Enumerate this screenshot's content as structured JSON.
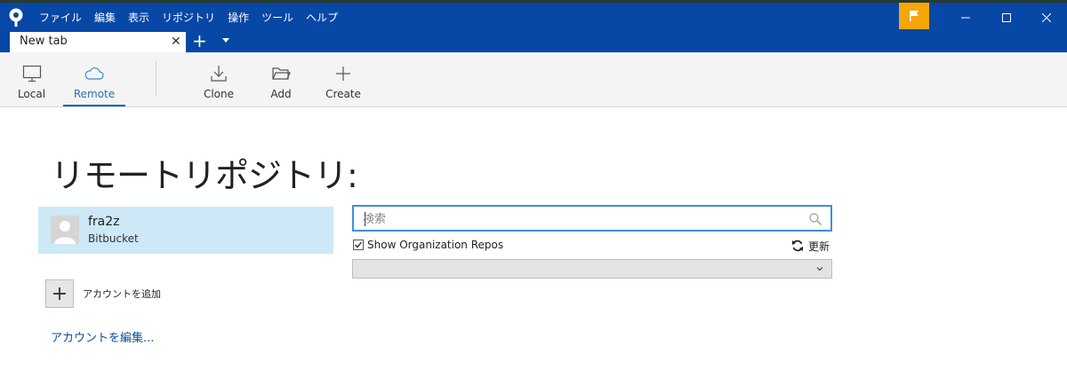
{
  "menu": [
    "ファイル",
    "編集",
    "表示",
    "リポジトリ",
    "操作",
    "ツール",
    "ヘルプ"
  ],
  "tabs": [
    {
      "label": "New tab",
      "close": "✕"
    }
  ],
  "new_tab_label": "+",
  "toolbar": {
    "local": "Local",
    "remote": "Remote",
    "clone": "Clone",
    "add": "Add",
    "create": "Create"
  },
  "page": {
    "heading": "リモートリポジトリ:"
  },
  "account": {
    "name": "fra2z",
    "service": "Bitbucket"
  },
  "add_account": {
    "icon": "+",
    "label": "アカウントを追加"
  },
  "edit_accounts_link": "アカウントを編集...",
  "search": {
    "placeholder": "検索",
    "value": ""
  },
  "show_org_repos": {
    "label": "Show Organization Repos",
    "checked": true
  },
  "refresh_label": "更新",
  "dropdown": {
    "selected": ""
  },
  "colors": {
    "titlebar": "#0747a6",
    "flag": "#f5a60a",
    "selected_account": "#cde8f6",
    "link": "#0b4ea2",
    "search_border": "#3d8ee3"
  }
}
